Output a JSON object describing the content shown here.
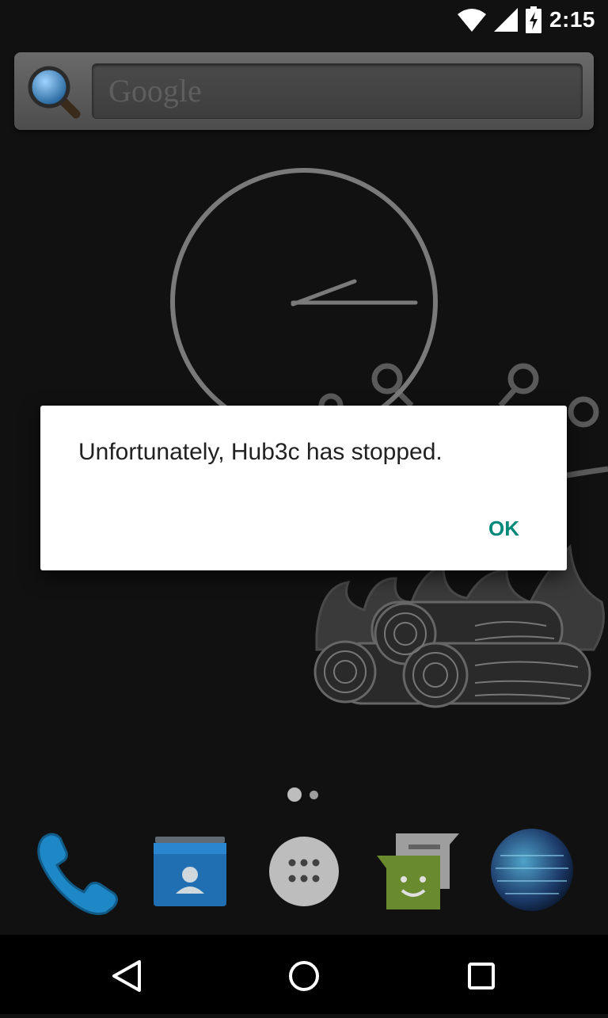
{
  "status_bar": {
    "time": "2:15",
    "icons": [
      "wifi-icon",
      "cell-signal-icon",
      "battery-charging-icon"
    ]
  },
  "search_widget": {
    "placeholder": "Google",
    "icon": "magnifier-icon"
  },
  "clock_widget": {
    "type": "analog",
    "hour_hand_reading": "2",
    "minute_hand_reading": "15"
  },
  "dialog": {
    "message": "Unfortunately, Hub3c has stopped.",
    "ok_label": "OK",
    "accent_color": "#00897b"
  },
  "home_pages": {
    "count": 2,
    "current": 1
  },
  "dock": {
    "items": [
      {
        "name": "phone",
        "icon": "phone-icon"
      },
      {
        "name": "contacts",
        "icon": "contacts-icon"
      },
      {
        "name": "app-drawer",
        "icon": "app-drawer-icon"
      },
      {
        "name": "messaging",
        "icon": "messaging-icon"
      },
      {
        "name": "browser",
        "icon": "globe-icon"
      }
    ]
  },
  "nav_bar": {
    "buttons": [
      "back-icon",
      "home-icon",
      "recents-icon"
    ]
  },
  "colors": {
    "background": "#111111",
    "dialog_bg": "#ffffff",
    "dialog_text": "#212121"
  }
}
